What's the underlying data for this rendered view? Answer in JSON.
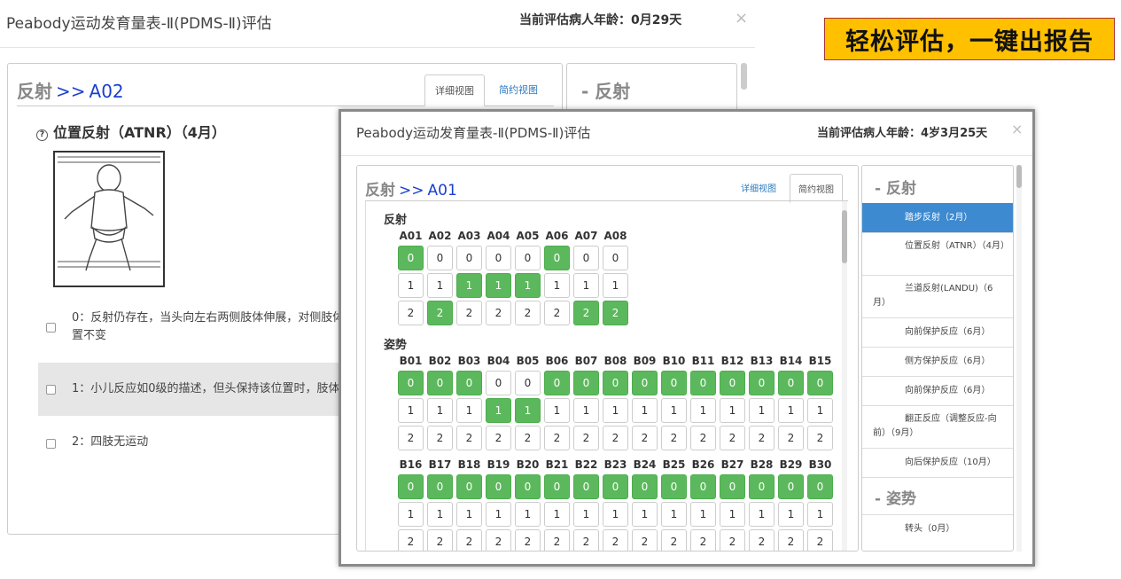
{
  "bg": {
    "title": "Peabody运动发育量表-Ⅱ(PDMS-Ⅱ)评估",
    "age": "当前评估病人年龄：0月29天",
    "close": "×",
    "crumb_section": "反射",
    "crumb_arrow": ">>",
    "crumb_code": "A02",
    "tab_detail": "详细视图",
    "tab_brief": "简约视图",
    "item_q": "?",
    "item_title": "位置反射（ATNR）（4月）",
    "options": [
      {
        "line1": "0：反射仍存在，当头向左右两侧肢体伸展，对侧肢体",
        "line2": "置不变"
      },
      {
        "line1": "1：小儿反应如0级的描述，但头保持该位置时，肢体",
        "line2": ""
      },
      {
        "line1": "2：四肢无运动",
        "line2": ""
      }
    ],
    "right_head": "- 反射"
  },
  "banner": "轻松评估，一键出报告",
  "fg": {
    "title": "Peabody运动发育量表-Ⅱ(PDMS-Ⅱ)评估",
    "age": "当前评估病人年龄：4岁3月25天",
    "close": "×",
    "crumb_section": "反射",
    "crumb_arrow": ">>",
    "crumb_code": "A01",
    "tab_detail": "详细视图",
    "tab_brief": "简约视图",
    "sections": [
      {
        "label": "反射",
        "groups": [
          {
            "codes": [
              "A01",
              "A02",
              "A03",
              "A04",
              "A05",
              "A06",
              "A07",
              "A08"
            ],
            "selected": [
              0,
              2,
              1,
              1,
              1,
              0,
              2,
              2
            ]
          }
        ]
      },
      {
        "label": "姿势",
        "groups": [
          {
            "codes": [
              "B01",
              "B02",
              "B03",
              "B04",
              "B05",
              "B06",
              "B07",
              "B08",
              "B09",
              "B10",
              "B11",
              "B12",
              "B13",
              "B14",
              "B15"
            ],
            "selected": [
              0,
              0,
              0,
              1,
              1,
              0,
              0,
              0,
              0,
              0,
              0,
              0,
              0,
              0,
              0
            ]
          },
          {
            "codes": [
              "B16",
              "B17",
              "B18",
              "B19",
              "B20",
              "B21",
              "B22",
              "B23",
              "B24",
              "B25",
              "B26",
              "B27",
              "B28",
              "B29",
              "B30"
            ],
            "selected": [
              0,
              0,
              0,
              0,
              0,
              0,
              0,
              0,
              0,
              0,
              0,
              0,
              0,
              0,
              0
            ]
          }
        ]
      }
    ],
    "right": {
      "head_reflex": "- 反射",
      "head_posture": "- 姿势",
      "items": [
        "踏步反射（2月）",
        "位置反射（ATNR）（4月）",
        "兰道反射(LANDU)（6月）",
        "向前保护反应（6月）",
        "侧方保护反应（6月）",
        "向前保护反应（6月）",
        "翻正反应（调整反应-向前）（9月）",
        "向后保护反应（10月）"
      ],
      "posture_items": [
        "转头（0月）"
      ]
    }
  }
}
